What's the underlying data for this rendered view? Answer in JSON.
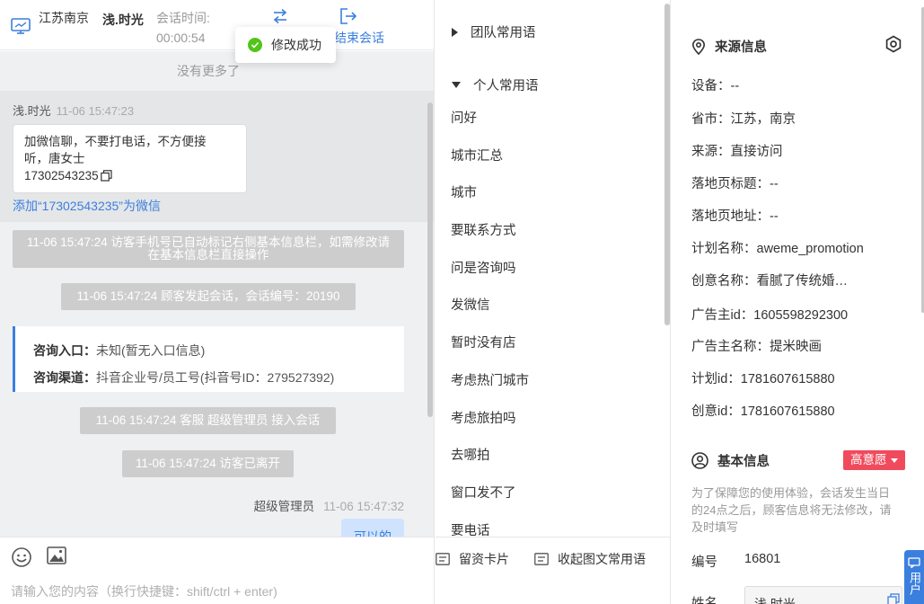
{
  "header": {
    "location": "江苏南京",
    "visitor_name": "浅.时光",
    "time_label": "会话时间:",
    "time_value": "00:00:54",
    "end_session": "结束会话",
    "toast": "修改成功"
  },
  "chat": {
    "no_more": "没有更多了",
    "sender": "浅.时光",
    "sender_time": "11-06 15:47:23",
    "visitor_message_line1": "加微信聊，不要打电话，不方便接",
    "visitor_message_line2": "听，唐女士",
    "visitor_phone": "17302543235",
    "add_wechat": "添加“17302543235”为微信",
    "sys_phone_marked": "11-06 15:47:24 访客手机号已自动标记右侧基本信息栏，如需修改请在基本信息栏直接操作",
    "sys_session_start": "11-06 15:47:24 顾客发起会话，会话编号：20190",
    "entry_label": "咨询入口：",
    "entry_value": "未知(暂无入口信息)",
    "channel_label": "咨询渠道：",
    "channel_value": "抖音企业号/员工号(抖音号ID：279527392)",
    "sys_agent_joined": "11-06 15:47:24 客服 超级管理员 接入会话",
    "sys_visitor_left": "11-06 15:47:24 访客已离开",
    "agent_name": "超级管理员",
    "agent_time": "11-06 15:47:32",
    "agent_message": "可以的"
  },
  "composer": {
    "placeholder": "请输入您的内容（换行快捷键：shift/ctrl + enter)"
  },
  "phrases": {
    "team_group": "团队常用语",
    "personal_group": "个人常用语",
    "items": [
      "问好",
      "城市汇总",
      "城市",
      "要联系方式",
      "问是咨询吗",
      "发微信",
      "暂时没有店",
      "考虑热门城市",
      "考虑旅拍吗",
      "去哪拍",
      "窗口发不了",
      "要电话"
    ],
    "btn_card": "留资卡片",
    "btn_collapse": "收起图文常用语"
  },
  "info": {
    "source_title": "来源信息",
    "rows": [
      "设备：--",
      "省市：江苏，南京",
      "来源：直接访问",
      "落地页标题：--",
      "落地页地址：--",
      "计划名称：aweme_promotion",
      "创意名称：看腻了传统婚纱照",
      "广告主id：1605598292300",
      "广告主名称：提米映画",
      "计划id：1781607615880",
      "创意id：1781607615880"
    ],
    "basic_title": "基本信息",
    "intent_badge": "高意愿",
    "basic_note": "为了保障您的使用体验，会话发生当日的24点之后，顾客信息将无法修改，请及时填写",
    "id_label": "编号",
    "id_value": "16801",
    "name_label": "姓名",
    "name_value": "浅.时光",
    "side_tab": "用户"
  },
  "colors": {
    "accent": "#3b7fde",
    "success": "#52c41a",
    "danger": "#f04b5c",
    "chat_bg": "#eff0f2",
    "system_pill": "#cdcdcd"
  }
}
